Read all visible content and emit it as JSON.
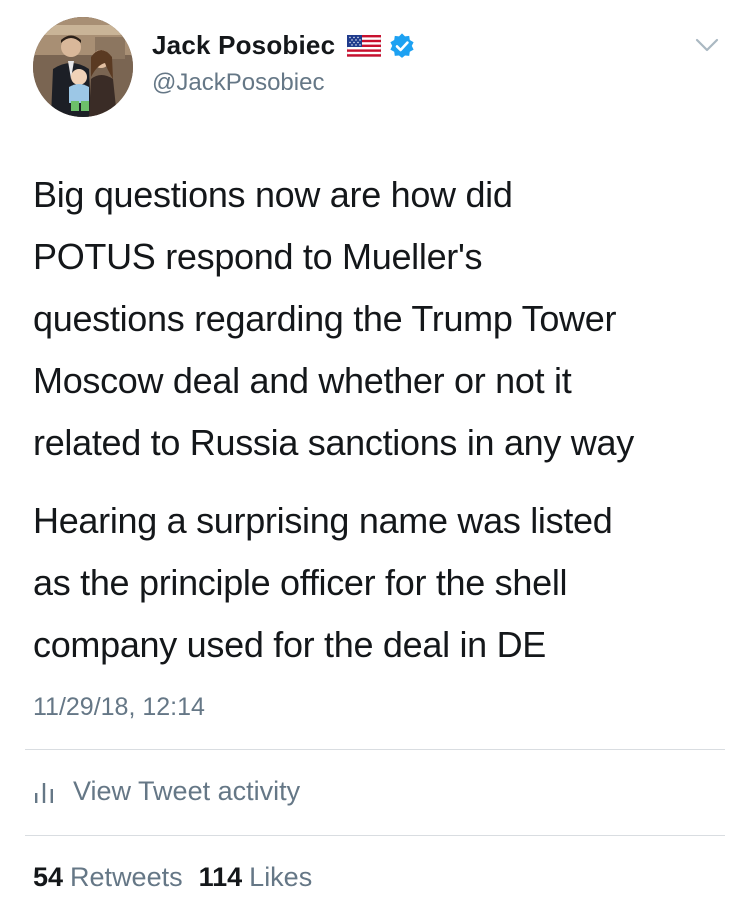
{
  "author": {
    "display_name": "Jack Posobiec",
    "handle": "@JackPosobiec",
    "flag_icon": "us-flag-icon",
    "verified_icon": "verified-badge-icon",
    "verified_color": "#1da1f2"
  },
  "tweet": {
    "paragraphs": [
      "Big questions now are how did POTUS respond to Mueller's questions regarding the Trump Tower Moscow deal and whether or not it related to Russia sanctions in any way",
      "Hearing a surprising name was listed as the principle officer for the shell company used for the deal in DE"
    ],
    "lines": [
      [
        "Big questions now are how did",
        "POTUS respond to Mueller's",
        "questions regarding the Trump Tower",
        "Moscow deal and whether or not it",
        "related to Russia sanctions in any way"
      ],
      [
        "Hearing a surprising name was listed",
        "as the principle officer for the shell",
        "company used for the deal in DE"
      ]
    ],
    "timestamp": "11/29/18, 12:14"
  },
  "activity": {
    "icon": "bar-chart-icon",
    "label": "View Tweet activity"
  },
  "stats": {
    "retweets_count": "54",
    "retweets_label": "Retweets",
    "likes_count": "114",
    "likes_label": "Likes"
  },
  "menu": {
    "icon": "chevron-down-icon"
  },
  "colors": {
    "text_primary": "#14171a",
    "text_secondary": "#657786",
    "divider": "#d9dde1",
    "accent": "#1da1f2"
  }
}
